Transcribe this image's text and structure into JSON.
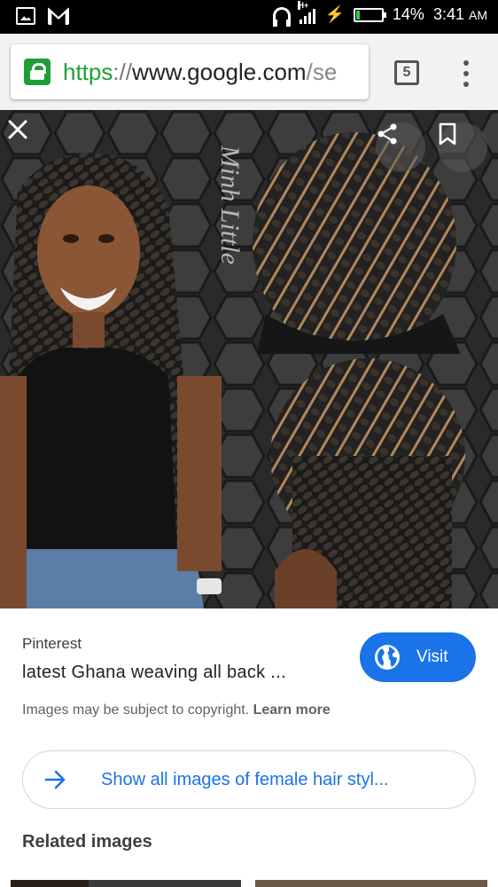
{
  "status_bar": {
    "network_label": "H+",
    "battery_percent": "14%",
    "battery_level": 0.14,
    "time": "3:41",
    "ampm": "AM",
    "icons": [
      "gallery-icon",
      "gmail-icon",
      "headphones-icon",
      "signal-icon",
      "charging-icon",
      "battery-icon"
    ]
  },
  "url_bar": {
    "scheme": "https",
    "separator": "://",
    "host": "www.google.com",
    "path": "/se",
    "tab_count": "5"
  },
  "viewer": {
    "watermark": "Minh Little",
    "icons": [
      "close-icon",
      "share-icon",
      "bookmark-icon"
    ]
  },
  "result": {
    "source": "Pinterest",
    "title": "latest Ghana weaving all back ...",
    "visit_label": "Visit",
    "copyright_text": "Images may be subject to copyright.",
    "learn_more": "Learn more",
    "show_all": "Show all images of female hair styl...",
    "related_heading": "Related images"
  },
  "colors": {
    "accent": "#1a73e8",
    "secure_green": "#1e9e3a",
    "status_bar": "#000000"
  }
}
